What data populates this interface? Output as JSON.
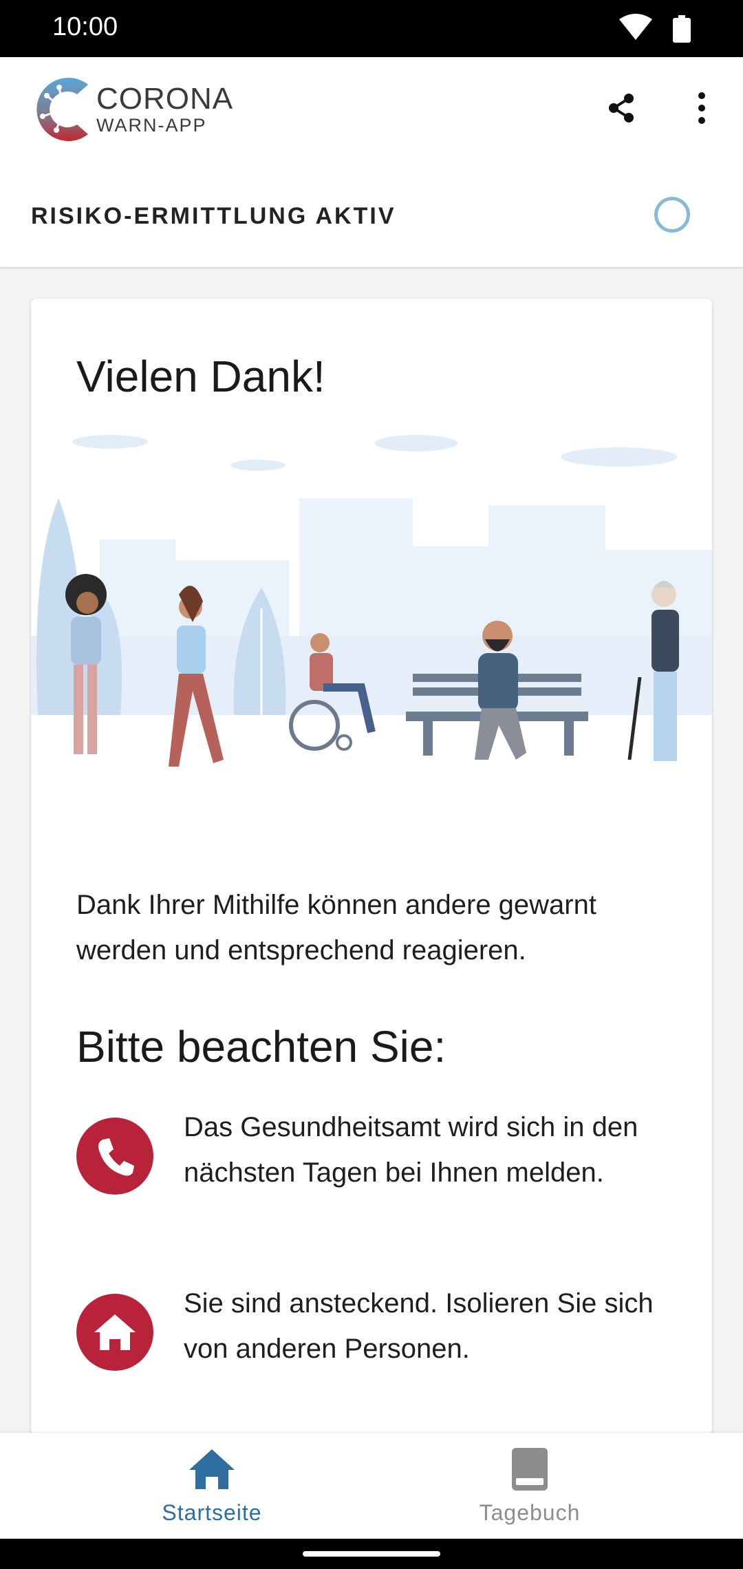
{
  "status_bar": {
    "time": "10:00"
  },
  "app_bar": {
    "logo_title": "CORONA",
    "logo_subtitle": "WARN-APP",
    "risk_label": "RISIKO-ERMITTLUNG AKTIV"
  },
  "card": {
    "title": "Vielen Dank!",
    "intro": "Dank Ihrer Mithilfe können andere gewarnt werden und entsprechend reagieren.",
    "section_title": "Bitte beachten Sie:",
    "bullets": [
      {
        "icon": "phone-icon",
        "text": "Das Gesundheitsamt wird sich in den nächsten Tagen bei Ihnen melden."
      },
      {
        "icon": "home-icon",
        "text": "Sie sind ansteckend. Isolieren Sie sich von anderen Personen."
      }
    ]
  },
  "bottom_nav": {
    "items": [
      {
        "label": "Startseite",
        "icon": "home-icon",
        "active": true
      },
      {
        "label": "Tagebuch",
        "icon": "book-icon",
        "active": false
      }
    ]
  },
  "colors": {
    "accent_blue": "#2e6ea1",
    "alert_red": "#b8233a",
    "inactive_gray": "#8d8d8d",
    "spinner": "#8ab9d6"
  }
}
